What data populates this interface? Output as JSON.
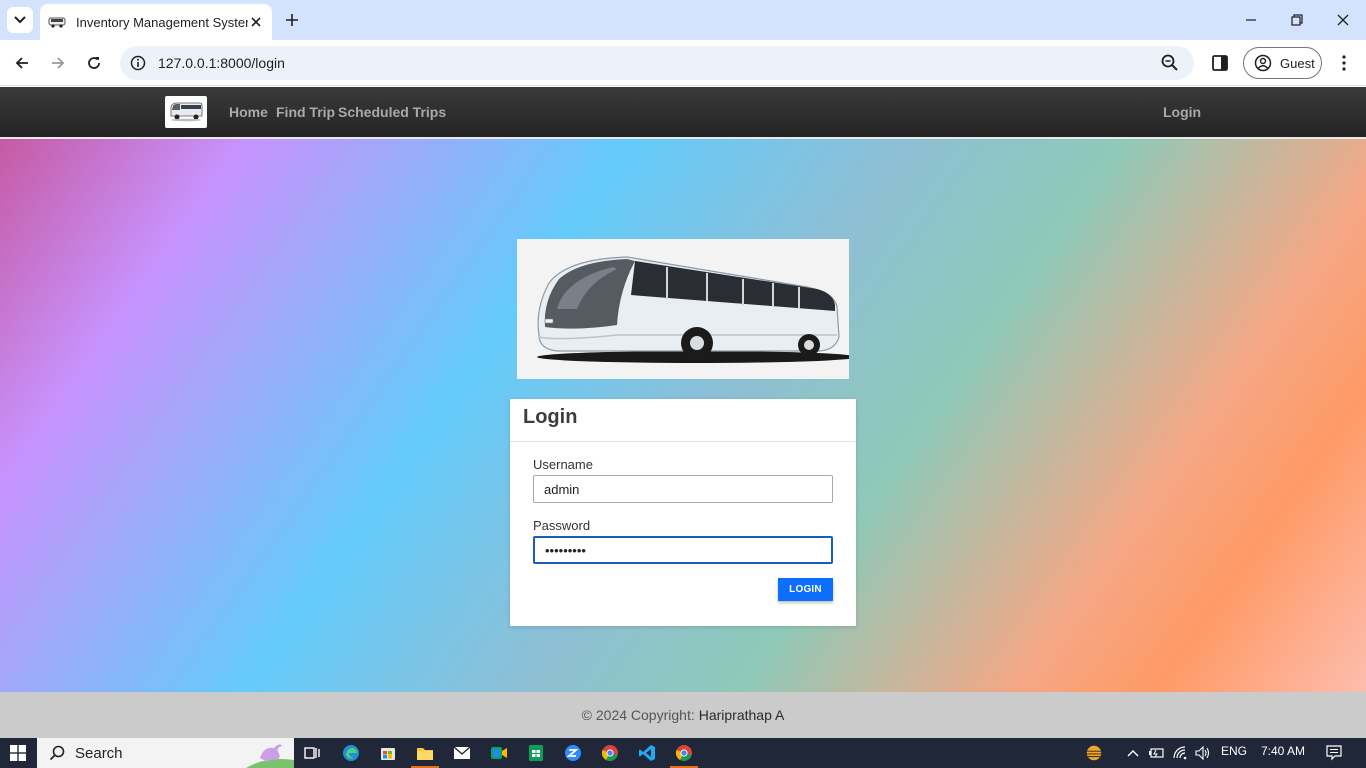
{
  "browser": {
    "tab_title": "Inventory Management System",
    "url": "127.0.0.1:8000/login",
    "profile_label": "Guest"
  },
  "navbar": {
    "links": [
      "Home",
      "Find Trip",
      "Scheduled Trips"
    ],
    "login_link": "Login"
  },
  "login_form": {
    "title": "Login",
    "username_label": "Username",
    "username_value": "admin",
    "password_label": "Password",
    "password_value": "•••••••••",
    "submit_label": "LOGIN"
  },
  "footer": {
    "copyright": "© 2024 Copyright:",
    "author": "Hariprathap A"
  },
  "taskbar": {
    "search_label": "Search",
    "language": "ENG",
    "time": "7:40 AM"
  },
  "colors": {
    "accent": "#0d6efd",
    "navbar_bg": "#2e2e2e",
    "footer_bg": "#cbcbcb"
  }
}
